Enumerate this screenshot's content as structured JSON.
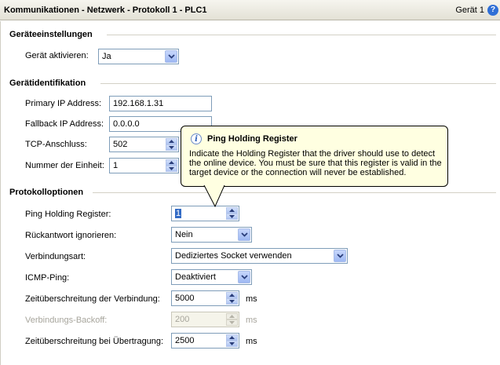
{
  "titlebar": {
    "title": "Kommunikationen - Netzwerk - Protokoll 1 - PLC1",
    "device": "Gerät 1",
    "help_icon": "help-circle-icon"
  },
  "sections": {
    "device_settings": "Geräteeinstellungen",
    "device_identification": "Gerätidentifikation",
    "protocol_options": "Protokolloptionen"
  },
  "device_settings": {
    "activate_label": "Gerät aktivieren:",
    "activate_value": "Ja"
  },
  "identification": {
    "primary_ip_label": "Primary IP Address:",
    "primary_ip_value": "192.168.1.31",
    "fallback_ip_label": "Fallback IP Address:",
    "fallback_ip_value": "0.0.0.0",
    "tcp_port_label": "TCP-Anschluss:",
    "tcp_port_value": "502",
    "unit_number_label": "Nummer der Einheit:",
    "unit_number_value": "1"
  },
  "protocol": {
    "ping_register_label": "Ping Holding Register:",
    "ping_register_value": "1",
    "ignore_reply_label": "Rückantwort ignorieren:",
    "ignore_reply_value": "Nein",
    "connection_type_label": "Verbindungsart:",
    "connection_type_value": "Dediziertes Socket verwenden",
    "icmp_label": "ICMP-Ping:",
    "icmp_value": "Deaktiviert",
    "conn_timeout_label": "Zeitüberschreitung der Verbindung:",
    "conn_timeout_value": "5000",
    "conn_timeout_unit": "ms",
    "backoff_label": "Verbindungs-Backoff:",
    "backoff_value": "200",
    "backoff_unit": "ms",
    "transfer_timeout_label": "Zeitüberschreitung bei Übertragung:",
    "transfer_timeout_value": "2500",
    "transfer_timeout_unit": "ms"
  },
  "tooltip": {
    "title": "Ping Holding Register",
    "text": "Indicate the Holding Register that the driver should use to detect the online device.  You must be sure that this register is valid in the target device or the connection will never be established."
  }
}
